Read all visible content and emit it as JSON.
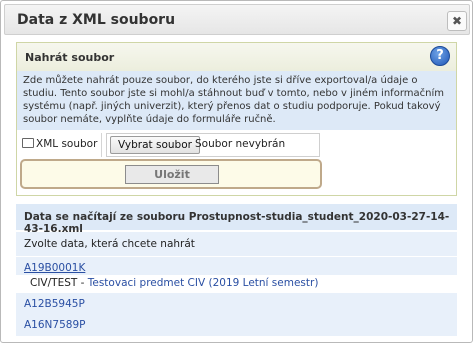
{
  "dialog": {
    "title": "Data z XML souboru",
    "close_label": "✖"
  },
  "upload": {
    "title": "Nahrát soubor",
    "help_label": "?",
    "info_text": "Zde můžete nahrát pouze soubor, do kterého jste si dříve exportoval/a údaje o studiu. Tento soubor jste si mohl/a stáhnout buď v tomto, nebo v jiném informačním systému (např. jiných univerzit), který přenos dat o studiu podporuje. Pokud takový soubor nemáte, vyplňte údaje do formuláře ručně.",
    "field_label": "XML soubor",
    "file_button": "Vybrat soubor",
    "file_status": "Soubor nevybrán",
    "save_button": "Uložit"
  },
  "data": {
    "title": "Data se načítají ze souboru Prostupnost-studia_student_2020-03-27-14-43-16.xml",
    "choose_text": "Zvolte data, která chcete nahrát",
    "items": [
      {
        "code": "A19B0001K",
        "detail_code": "CIV/TEST",
        "detail_sep": " - ",
        "detail_name": "Testovaci predmet CIV (2019 Letní semestr)"
      },
      {
        "code": "A12B5945P"
      },
      {
        "code": "A16N7589P"
      }
    ]
  }
}
